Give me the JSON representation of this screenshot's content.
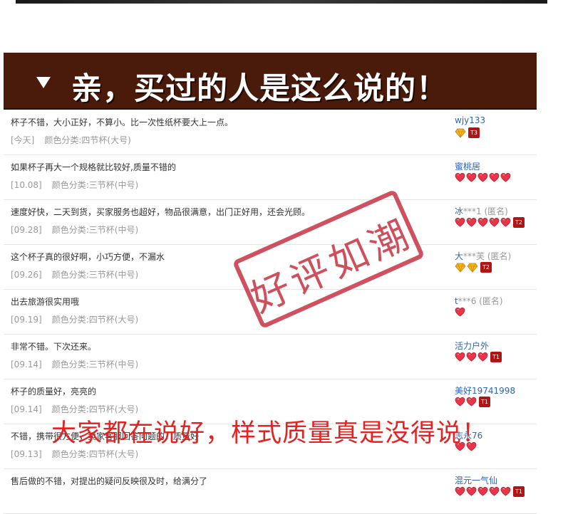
{
  "banner": {
    "title": "亲，买过的人是这么说的！"
  },
  "reviews": [
    {
      "text": "杯子不错，大小正好，不算小。比一次性纸杯要大上一点。",
      "date": "[今天]",
      "sku": "颜色分类:四节杯(大号)",
      "user": "wjy133",
      "user_star": "",
      "anon": "",
      "hearts": 0,
      "diamonds": 1,
      "tag": "T3"
    },
    {
      "text": "如果杯子再大一个规格就比较好,质量不错的",
      "date": "[10.08]",
      "sku": "颜色分类:三节杯(中号)",
      "user": "蜜桃居",
      "user_star": "",
      "anon": "",
      "hearts": 5,
      "diamonds": 0,
      "tag": ""
    },
    {
      "text": "速度好快，二天到货，买家服务也超好，物品很满意，出门正好用，还会光顾。",
      "date": "[09.28]",
      "sku": "颜色分类:三节杯(中号)",
      "user": "冰",
      "user_star": "***1",
      "anon": "(匿名)",
      "hearts": 5,
      "diamonds": 0,
      "tag": "T2"
    },
    {
      "text": "这个杯子真的很好啊，小巧方便，不漏水",
      "date": "[09.26]",
      "sku": "颜色分类:三节杯(中号)",
      "user": "大",
      "user_star": "***芙",
      "anon": "(匿名)",
      "hearts": 0,
      "diamonds": 2,
      "tag": "T2"
    },
    {
      "text": "出去旅游很实用哦",
      "date": "[09.19]",
      "sku": "颜色分类:四节杯(大号)",
      "user": "t",
      "user_star": "***6",
      "anon": "(匿名)",
      "hearts": 1,
      "diamonds": 0,
      "tag": ""
    },
    {
      "text": "非常不错。下次还来。",
      "date": "[09.14]",
      "sku": "颜色分类:三节杯(中号)",
      "user": "活力户外",
      "user_star": "",
      "anon": "",
      "hearts": 3,
      "diamonds": 0,
      "tag": "T1"
    },
    {
      "text": "杯子的质量好，亮亮的",
      "date": "[09.14]",
      "sku": "颜色分类:四节杯(大号)",
      "user": "美好19741998",
      "user_star": "",
      "anon": "",
      "hearts": 2,
      "diamonds": 0,
      "tag": "T1"
    },
    {
      "text": "不错，携带很方便，卖家客服回答问题的，质量好",
      "date": "[09.13]",
      "sku": "颜色分类:四节杯(大号)",
      "user": "志永76",
      "user_star": "",
      "anon": "",
      "hearts": 2,
      "diamonds": 0,
      "tag": ""
    },
    {
      "text": "售后做的不错，对提出的疑问反映很及时，给满分了",
      "date": "",
      "sku": "",
      "user": "混元一气仙",
      "user_star": "",
      "anon": "",
      "hearts": 5,
      "diamonds": 0,
      "tag": "T1"
    }
  ],
  "stamp": {
    "text": "好评如潮"
  },
  "slogan": {
    "text": "大家都在说好，样式质量真是没得说！"
  },
  "colors": {
    "banner_bg": "#4a1b0b",
    "stamp": "#c42a3a",
    "slogan": "#e32222",
    "username": "#2d64b3",
    "heart": "#e8354a"
  }
}
